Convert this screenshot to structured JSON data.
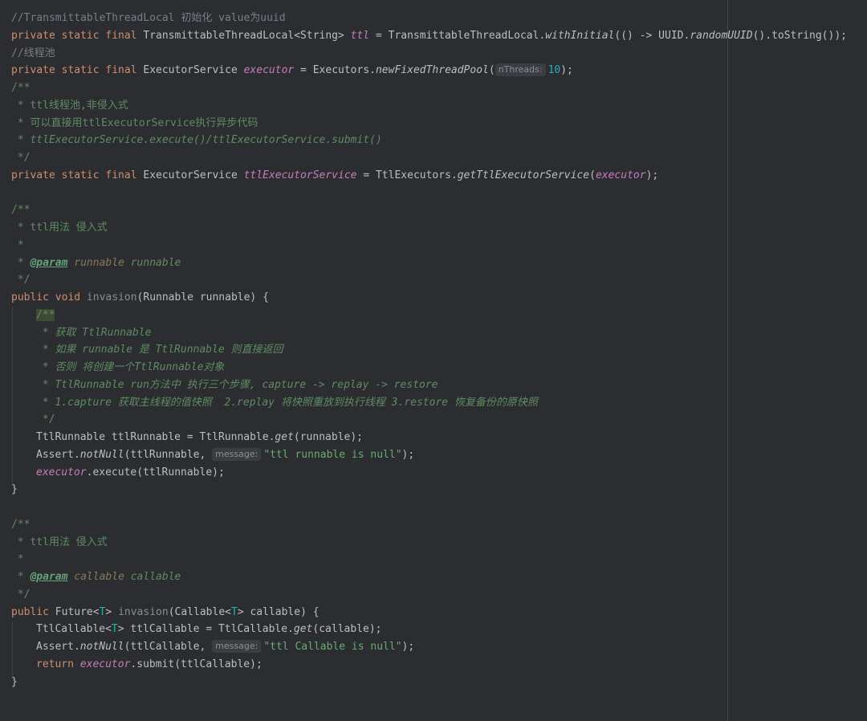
{
  "lines": {
    "l1_comment": "//TransmittableThreadLocal 初始化 value为uuid",
    "l2": {
      "mods": "private static final ",
      "type": "TransmittableThreadLocal<String> ",
      "field": "ttl",
      "eq": " = TransmittableThreadLocal.",
      "call": "withInitial",
      "mid": "(() -> UUID.",
      "call2": "randomUUID",
      "end": "().toString());"
    },
    "l3_comment": "//线程池",
    "l4": {
      "mods": "private static final ",
      "type": "ExecutorService ",
      "field": "executor",
      "eq": " = Executors.",
      "call": "newFixedThreadPool",
      "open": "(",
      "hint": "nThreads:",
      "num": "10",
      "end": ");"
    },
    "l5": "/**",
    "l6": " * ttl线程池,非侵入式",
    "l7": " * 可以直接用ttlExecutorService执行异步代码",
    "l8": " * ttlExecutorService.execute()/ttlExecutorService.submit()",
    "l9": " */",
    "l10": {
      "mods": "private static final ",
      "type": "ExecutorService ",
      "field": "ttlExecutorService",
      "eq": " = TtlExecutors.",
      "call": "getTtlExecutorService",
      "open": "(",
      "arg": "executor",
      "end": ");"
    },
    "l12": "/**",
    "l13": " * ttl用法 侵入式",
    "l14": " *",
    "l15": {
      "star": " * ",
      "tag": "@param",
      "sp": " ",
      "name": "runnable",
      "desc": " runnable"
    },
    "l16": " */",
    "l17": {
      "kw": "public void ",
      "name": "invasion",
      "rest": "(Runnable runnable) {"
    },
    "l18": "/**",
    "l19": " * 获取 TtlRunnable",
    "l20": " * 如果 runnable 是 TtlRunnable 则直接返回",
    "l21": " * 否则 将创建一个TtlRunnable对象",
    "l22": " * TtlRunnable run方法中 执行三个步骤, capture -> replay -> restore",
    "l23": " * 1.capture 获取主线程的值快照  2.replay 将快照重放到执行线程 3.restore 恢复备份的原快照",
    "l24": " */",
    "l25": {
      "a": "TtlRunnable ttlRunnable = TtlRunnable.",
      "call": "get",
      "b": "(runnable);"
    },
    "l26": {
      "a": "Assert.",
      "call": "notNull",
      "b": "(ttlRunnable, ",
      "hint": "message:",
      "str": "\"ttl runnable is null\"",
      "end": ");"
    },
    "l27": {
      "field": "executor",
      "rest": ".execute(ttlRunnable);"
    },
    "l28": "}",
    "l30": "/**",
    "l31": " * ttl用法 侵入式",
    "l32": " *",
    "l33": {
      "star": " * ",
      "tag": "@param",
      "sp": " ",
      "name": "callable",
      "desc": " callable"
    },
    "l34": " */",
    "l35": {
      "kw": "public ",
      "a": "Future<",
      "gen": "T",
      "b": "> ",
      "name": "invasion",
      "c": "(Callable<",
      "gen2": "T",
      "d": "> callable) {"
    },
    "l36": {
      "a": "TtlCallable<",
      "gen": "T",
      "b": "> ttlCallable = TtlCallable.",
      "call": "get",
      "c": "(callable);"
    },
    "l37": {
      "a": "Assert.",
      "call": "notNull",
      "b": "(ttlCallable, ",
      "hint": "message:",
      "str": "\"ttl Callable is null\"",
      "end": ");"
    },
    "l38": {
      "kw": "return ",
      "field": "executor",
      "rest": ".submit(ttlCallable);"
    },
    "l39": "}"
  },
  "colors": {
    "background": "#2b2d30",
    "keyword": "#cf8e6d",
    "field": "#c77dbb",
    "doc_comment": "#5f8c63",
    "line_comment": "#7a7e85",
    "number": "#2aacb8",
    "string": "#6aab73"
  }
}
